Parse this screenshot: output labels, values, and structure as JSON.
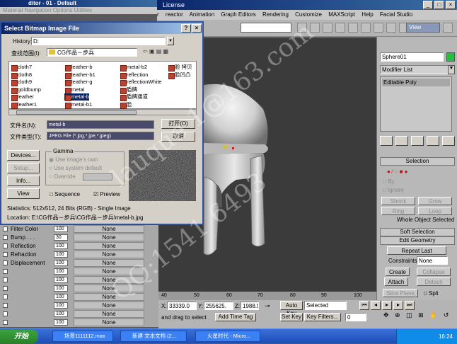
{
  "material_editor": {
    "title": "ditor - 01 - Default",
    "menu": "Material Navigation Options Utilities",
    "map_rows": [
      {
        "label": "Filter Color",
        "value": "100",
        "map": "None"
      },
      {
        "label": "Bump . . .",
        "value": "30",
        "map": "None"
      },
      {
        "label": "Reflection",
        "value": "100",
        "map": "None"
      },
      {
        "label": "Refraction",
        "value": "100",
        "map": "None"
      },
      {
        "label": "Displacement",
        "value": "100",
        "map": "None"
      },
      {
        "label": "",
        "value": "100",
        "map": "None"
      },
      {
        "label": "",
        "value": "100",
        "map": "None"
      },
      {
        "label": "",
        "value": "100",
        "map": "None"
      },
      {
        "label": "",
        "value": "100",
        "map": "None"
      },
      {
        "label": "",
        "value": "100",
        "map": "None"
      },
      {
        "label": "",
        "value": "100",
        "map": "None"
      },
      {
        "label": "",
        "value": "100",
        "map": "None"
      },
      {
        "label": "",
        "value": "100",
        "map": "None"
      }
    ]
  },
  "max_window": {
    "title": "License",
    "menu": [
      "r",
      "reactor",
      "Animation",
      "Graph Editors",
      "Rendering",
      "Customize",
      "MAXScript",
      "Help",
      "Facial Studio"
    ],
    "view_combo": "View"
  },
  "dialog": {
    "title": "Select Bitmap Image File",
    "history_label": "History:",
    "history_value": "D:",
    "lookin_label": "查找范围(I):",
    "lookin_value": "CG作品－步兵",
    "files": [
      {
        "name": "cloth7",
        "col": 0,
        "row": 0
      },
      {
        "name": "cloth8",
        "col": 0,
        "row": 1
      },
      {
        "name": "cloth9",
        "col": 0,
        "row": 2
      },
      {
        "name": "goldbump",
        "col": 0,
        "row": 3
      },
      {
        "name": "leather",
        "col": 0,
        "row": 4
      },
      {
        "name": "leather1",
        "col": 0,
        "row": 5
      },
      {
        "name": "leather-b",
        "col": 1,
        "row": 0
      },
      {
        "name": "leather-b1",
        "col": 1,
        "row": 1
      },
      {
        "name": "leather-g",
        "col": 1,
        "row": 2
      },
      {
        "name": "metal",
        "col": 1,
        "row": 3
      },
      {
        "name": "metal-b",
        "col": 1,
        "row": 4,
        "selected": true
      },
      {
        "name": "metal-b1",
        "col": 1,
        "row": 5
      },
      {
        "name": "metal-b2",
        "col": 2,
        "row": 0
      },
      {
        "name": "reflection",
        "col": 2,
        "row": 1
      },
      {
        "name": "reflectionWhite",
        "col": 2,
        "row": 2
      },
      {
        "name": "盾牌",
        "col": 2,
        "row": 3
      },
      {
        "name": "盾牌通道",
        "col": 2,
        "row": 4
      },
      {
        "name": "脸",
        "col": 2,
        "row": 5
      },
      {
        "name": "脸 拷贝",
        "col": 3,
        "row": 0
      },
      {
        "name": "脸凹凸",
        "col": 3,
        "row": 1
      }
    ],
    "filename_label": "文件名(N):",
    "filename_value": "metal-b",
    "filetype_label": "文件类型(T):",
    "filetype_value": "JPEG File (*.jpg,*.jpe,*.jpeg)",
    "open_button": "打开(O)",
    "cancel_button": "取消",
    "devices_button": "Devices...",
    "setup_button": "Setup...",
    "info_button": "Info...",
    "view_button": "View",
    "gamma_label": "Gamma",
    "gamma_opt1": "Use image's own",
    "gamma_opt2": "Use system default",
    "gamma_opt3": "Override",
    "sequence_label": "Sequence",
    "preview_label": "Preview",
    "statistics": "Statistics: 512x512, 24 Bits (RGB) - Single Image",
    "location": "Location: E:\\CG作品－步兵\\CG作品－步兵\\metal-b.jpg"
  },
  "command_panel": {
    "object_name": "Sphere01",
    "modifier_list": "Modifier List",
    "stack_item": "Editable Poly",
    "selection_rollout": "Selection",
    "by_vertex": "By",
    "ignore_backfacing": "Ignore",
    "shrink": "Shrink",
    "grow": "Grow",
    "ring": "Ring",
    "loop": "Loop",
    "whole_selected": "Whole Object Selected",
    "soft_selection": "Soft Selection",
    "edit_geometry": "Edit Geometry",
    "repeat_last": "Repeat Last",
    "constraints_label": "Constraints",
    "constraints_value": "None",
    "create": "Create",
    "collapse": "Collapse",
    "attach": "Attach",
    "detach": "Detach",
    "slice_plane": "Slice Plane",
    "split": "Spli"
  },
  "timeline": {
    "ticks": [
      "40",
      "50",
      "60",
      "70",
      "80",
      "90",
      "100"
    ]
  },
  "status": {
    "x_label": "X:",
    "x_value": "33339.0",
    "y_label": "Y:",
    "y_value": "255625.",
    "z_label": "Z:",
    "z_value": "1988.9",
    "auto_key": "Auto Key",
    "selected": "Selected",
    "set_key": "Set Key",
    "key_filters": "Key Filters...",
    "prompt": "and drag to select",
    "add_time_tag": "Add Time Tag",
    "frame": "0"
  },
  "taskbar": {
    "start": "开始",
    "tasks": [
      "场景1111112.max",
      "新建 文本文档 (2...",
      "火星时代 - Micro..."
    ],
    "clock": "16:24"
  },
  "watermark": {
    "line1": "lauque 1@163.com",
    "line2": "QQ:1541 6493"
  }
}
